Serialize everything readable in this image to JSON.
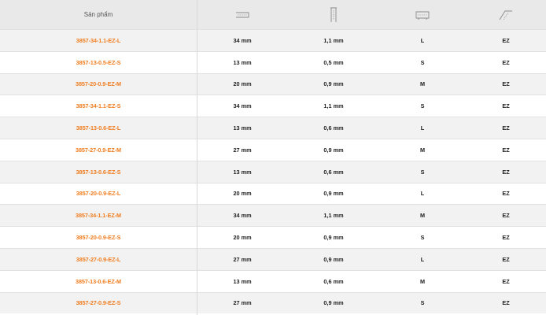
{
  "table": {
    "header": {
      "product_label": "Sản phẩm",
      "icons": [
        "staple-width-icon",
        "staple-leg-icon",
        "staple-size-icon",
        "staple-type-icon"
      ]
    },
    "rows": [
      {
        "sku": "3857-34-1.1-EZ-L",
        "width": "34 mm",
        "thickness": "1,1 mm",
        "size": "L",
        "type": "EZ"
      },
      {
        "sku": "3857-13-0.5-EZ-S",
        "width": "13 mm",
        "thickness": "0,5 mm",
        "size": "S",
        "type": "EZ"
      },
      {
        "sku": "3857-20-0.9-EZ-M",
        "width": "20 mm",
        "thickness": "0,9 mm",
        "size": "M",
        "type": "EZ"
      },
      {
        "sku": "3857-34-1.1-EZ-S",
        "width": "34 mm",
        "thickness": "1,1 mm",
        "size": "S",
        "type": "EZ"
      },
      {
        "sku": "3857-13-0.6-EZ-L",
        "width": "13 mm",
        "thickness": "0,6 mm",
        "size": "L",
        "type": "EZ"
      },
      {
        "sku": "3857-27-0.9-EZ-M",
        "width": "27 mm",
        "thickness": "0,9 mm",
        "size": "M",
        "type": "EZ"
      },
      {
        "sku": "3857-13-0.6-EZ-S",
        "width": "13 mm",
        "thickness": "0,6 mm",
        "size": "S",
        "type": "EZ"
      },
      {
        "sku": "3857-20-0.9-EZ-L",
        "width": "20 mm",
        "thickness": "0,9 mm",
        "size": "L",
        "type": "EZ"
      },
      {
        "sku": "3857-34-1.1-EZ-M",
        "width": "34 mm",
        "thickness": "1,1 mm",
        "size": "M",
        "type": "EZ"
      },
      {
        "sku": "3857-20-0.9-EZ-S",
        "width": "20 mm",
        "thickness": "0,9 mm",
        "size": "S",
        "type": "EZ"
      },
      {
        "sku": "3857-27-0.9-EZ-L",
        "width": "27 mm",
        "thickness": "0,9 mm",
        "size": "L",
        "type": "EZ"
      },
      {
        "sku": "3857-13-0.6-EZ-M",
        "width": "13 mm",
        "thickness": "0,6 mm",
        "size": "M",
        "type": "EZ"
      },
      {
        "sku": "3857-27-0.9-EZ-S",
        "width": "27 mm",
        "thickness": "0,9 mm",
        "size": "S",
        "type": "EZ"
      }
    ]
  },
  "colors": {
    "sku_link": "#f07d20",
    "header_bg": "#e9e9e9",
    "row_alt_bg": "#f2f2f2",
    "text": "#222222"
  }
}
